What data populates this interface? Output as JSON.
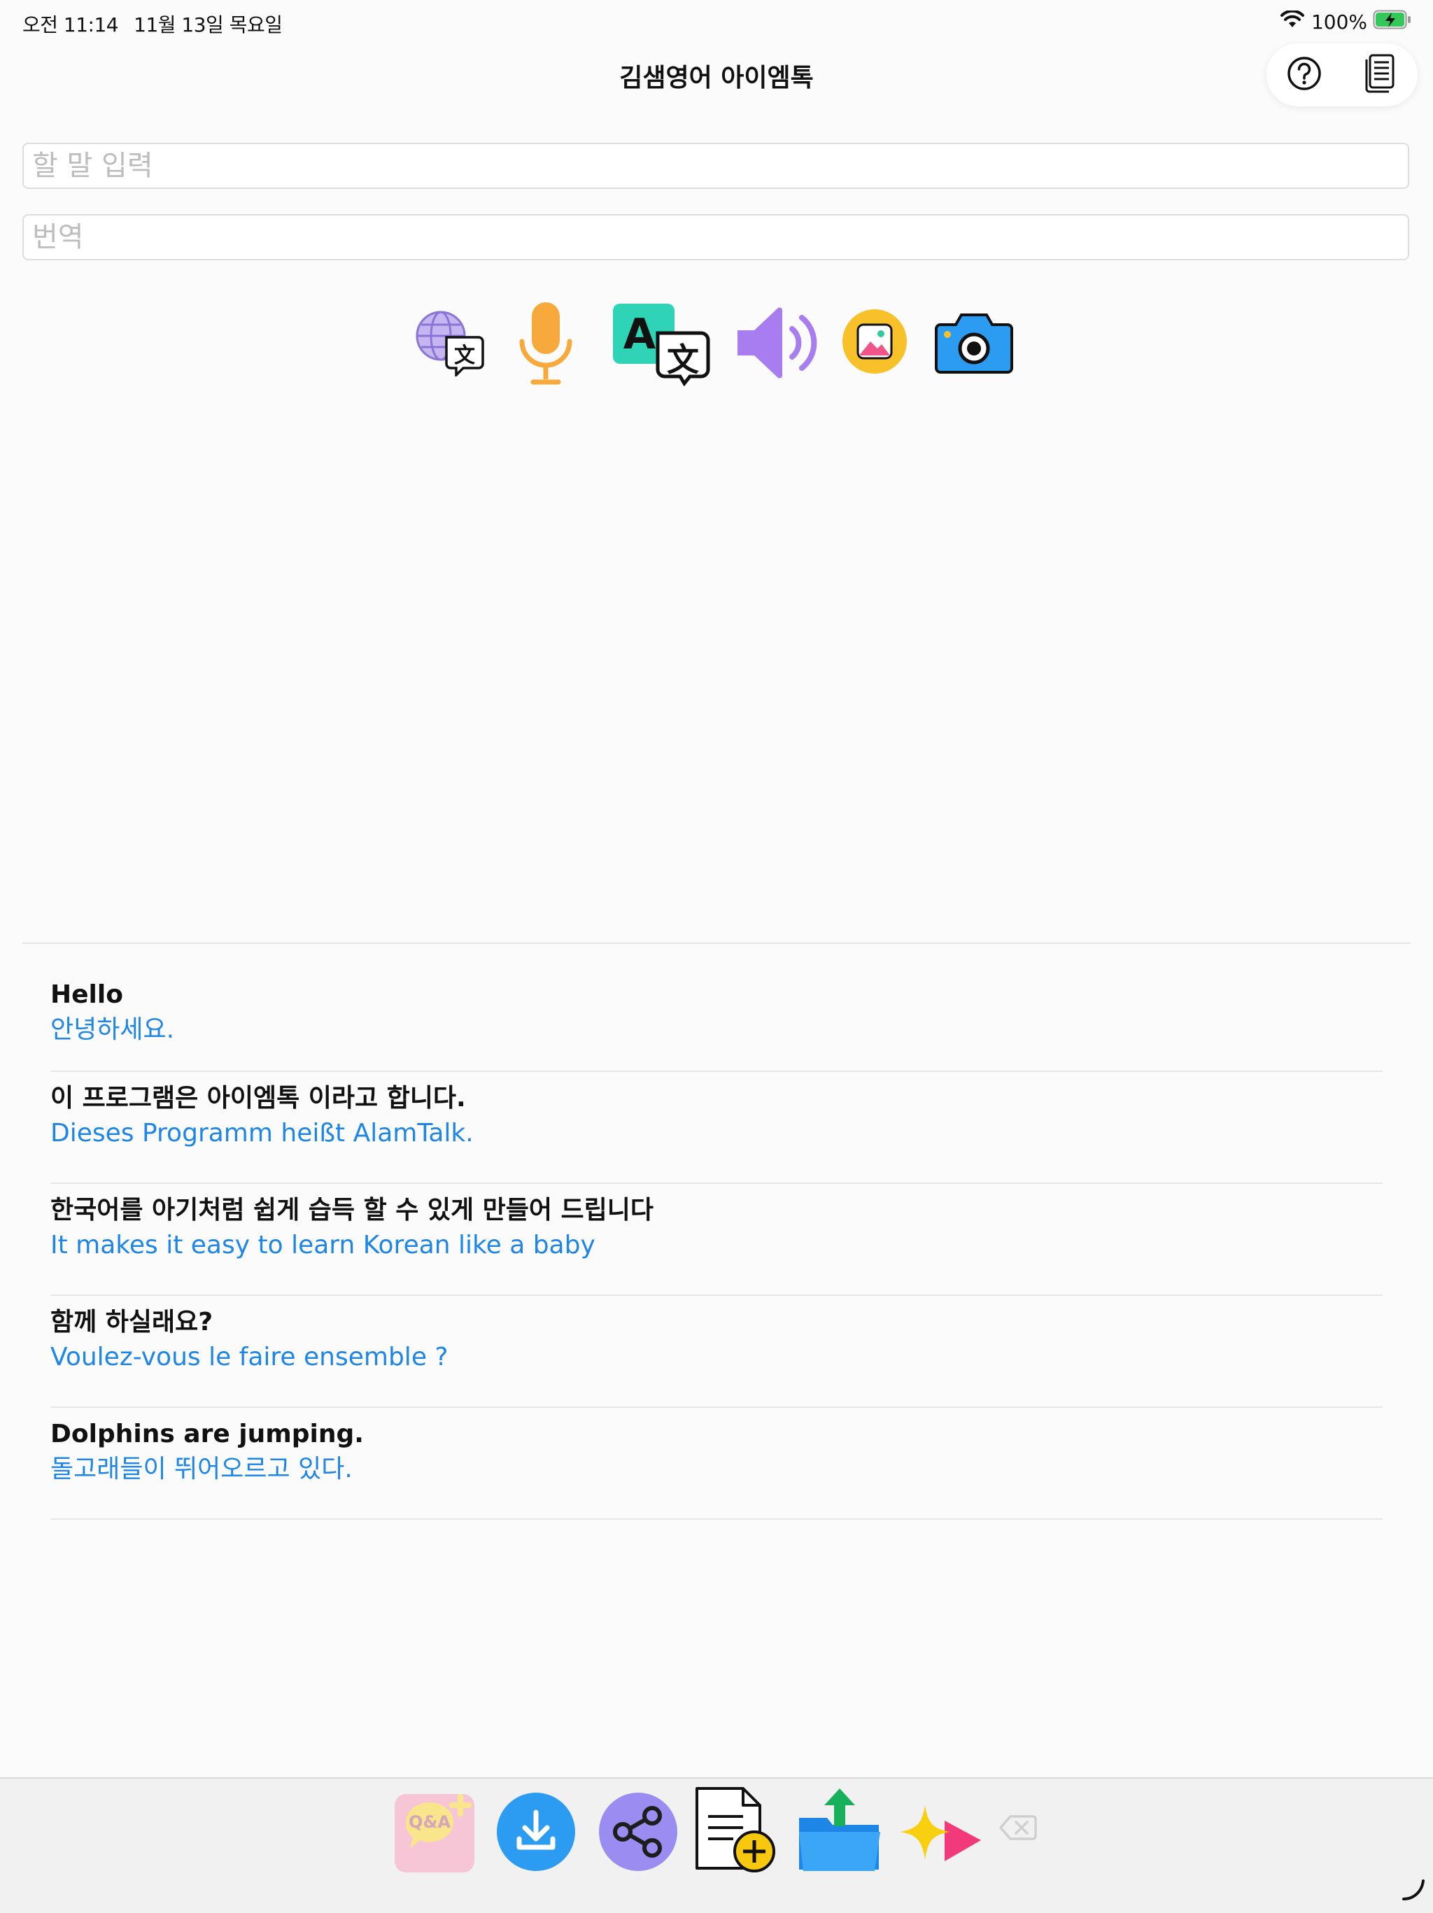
{
  "status": {
    "time": "오전 11:14",
    "date": "11월 13일 목요일",
    "battery": "100%"
  },
  "nav": {
    "title": "김샘영어 아이엠톡"
  },
  "inputs": {
    "speak_placeholder": "할 말 입력",
    "translation_placeholder": "번역"
  },
  "icons": {
    "toolbar": [
      "language-select-icon",
      "microphone-icon",
      "translate-icon",
      "speaker-icon",
      "photo-icon",
      "camera-icon"
    ],
    "bottom": [
      "qa-add-icon",
      "download-icon",
      "share-icon",
      "new-document-icon",
      "folder-upload-icon",
      "sparkle-play-icon",
      "clear-icon"
    ],
    "nav": [
      "help-icon",
      "notes-icon"
    ]
  },
  "colors": {
    "accent_blue": "#1e86e6",
    "mic_orange": "#f7a93b",
    "translate_teal": "#2fd3b5",
    "speaker_purple": "#a77df0",
    "photo_yellow": "#f8c12a",
    "camera_blue": "#2b9cf2"
  },
  "phrases": [
    {
      "source": "Hello",
      "translation": "안녕하세요."
    },
    {
      "source": "이 프로그램은 아이엠톡 이라고 합니다.",
      "translation": "Dieses Programm heißt AlamTalk."
    },
    {
      "source": "한국어를 아기처럼 쉽게 습득 할 수 있게 만들어 드립니다",
      "translation": "It makes it easy to learn Korean like a baby"
    },
    {
      "source": "함께 하실래요?",
      "translation": "Voulez-vous le faire ensemble ?"
    },
    {
      "source": "Dolphins are jumping.",
      "translation": "돌고래들이 뛰어오르고 있다."
    }
  ],
  "bottom": {
    "qa_label": "Q&A"
  }
}
